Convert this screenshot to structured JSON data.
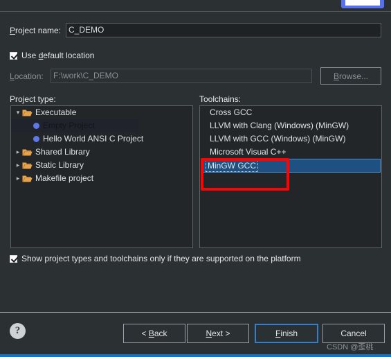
{
  "top_partial_button": {
    "name": "partial-blue-button"
  },
  "form": {
    "project_name_label": "Project name:",
    "project_name_value": "C_DEMO",
    "use_default_location_label": "Use default location",
    "location_label": "Location:",
    "location_value": "F:\\work\\C_DEMO",
    "browse_label": "Browse..."
  },
  "project_type": {
    "title": "Project type:",
    "items": [
      {
        "label": "Executable",
        "type": "folder",
        "expanded": true,
        "indent": 0,
        "selected": false
      },
      {
        "label": "Empty Project",
        "type": "bullet",
        "indent": 2,
        "selected": true
      },
      {
        "label": "Hello World ANSI C Project",
        "type": "bullet",
        "indent": 2,
        "selected": false
      },
      {
        "label": "Shared Library",
        "type": "folder",
        "expanded": false,
        "indent": 0,
        "selected": false
      },
      {
        "label": "Static Library",
        "type": "folder",
        "expanded": false,
        "indent": 0,
        "selected": false
      },
      {
        "label": "Makefile project",
        "type": "folder",
        "expanded": false,
        "indent": 0,
        "selected": false
      }
    ]
  },
  "toolchains": {
    "title": "Toolchains:",
    "items": [
      {
        "label": "Cross GCC",
        "selected": false
      },
      {
        "label": "LLVM with Clang (Windows) (MinGW)",
        "selected": false
      },
      {
        "label": "LLVM with GCC (Windows) (MinGW)",
        "selected": false
      },
      {
        "label": "Microsoft Visual C++",
        "selected": false
      },
      {
        "label": "MinGW GCC",
        "selected": true
      }
    ]
  },
  "show_supported_label": "Show project types and toolchains only if they are supported on the platform",
  "buttons": {
    "back": "< Back",
    "next": "Next >",
    "finish": "Finish",
    "cancel": "Cancel",
    "help": "?"
  },
  "watermark": "CSDN @歪桃",
  "colors": {
    "window_bg": "#2b3033",
    "field_bg": "#1e2225",
    "list_bg": "#222629",
    "selection_blue": "#1e5181",
    "focus_blue": "#2f7fd4",
    "annotation_red": "#fd0303",
    "folder_orange": "#e8a34a",
    "bullet_blue": "#5f78e8",
    "bottom_accent": "#1474c4"
  }
}
